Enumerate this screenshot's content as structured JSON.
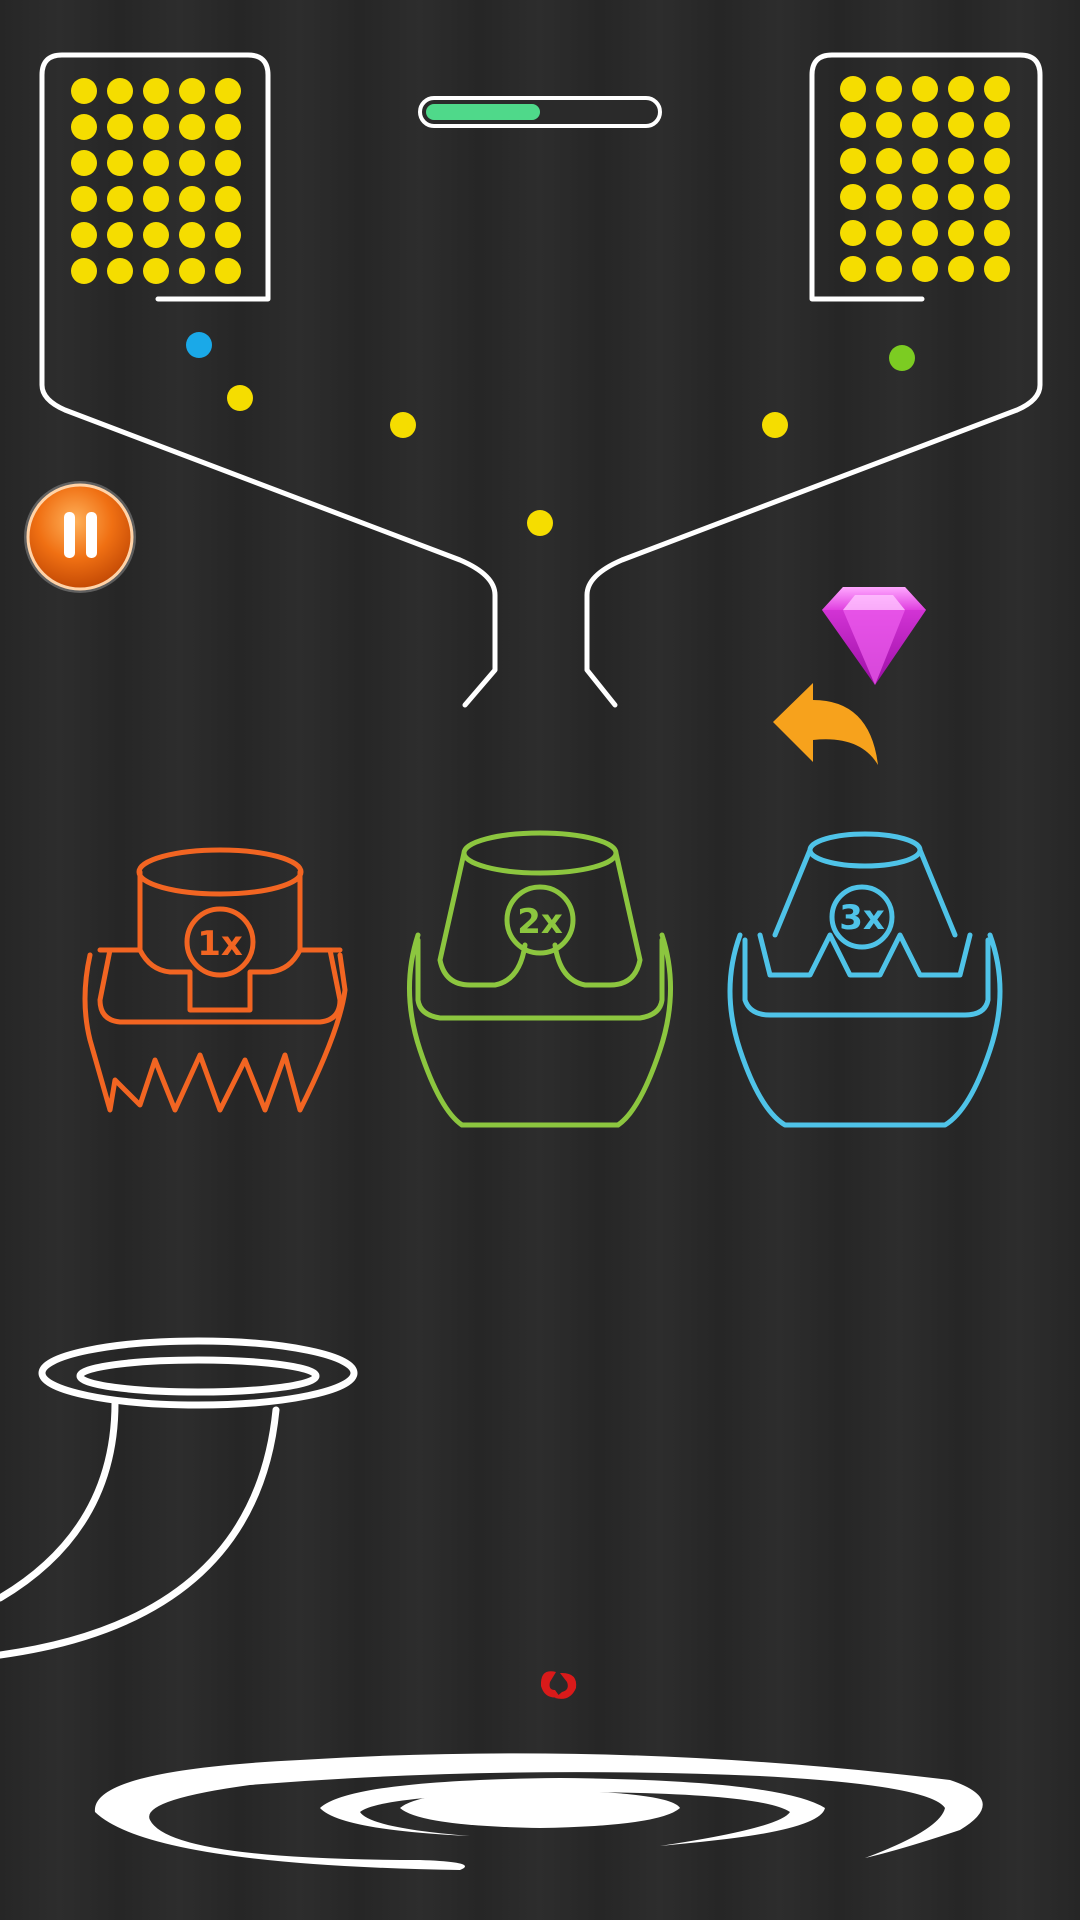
{
  "progress": {
    "fraction": 0.5
  },
  "ball_colors": {
    "yellow": "#f5dd00",
    "blue": "#1aa9e8",
    "green": "#7ccc22"
  },
  "pause_button": {
    "icon": "pause-icon",
    "color": "#f07013"
  },
  "gem": {
    "icon": "gem-icon",
    "color": "#e040e0"
  },
  "undo": {
    "icon": "undo-arrow-icon",
    "color": "#f7a21c"
  },
  "cups": [
    {
      "multiplier": "1x",
      "color": "#f26522"
    },
    {
      "multiplier": "2x",
      "color": "#8cc63f"
    },
    {
      "multiplier": "3x",
      "color": "#4fc3e8"
    }
  ],
  "hint_icon": {
    "icon": "red-hint-icon",
    "color": "#d91a1a"
  }
}
